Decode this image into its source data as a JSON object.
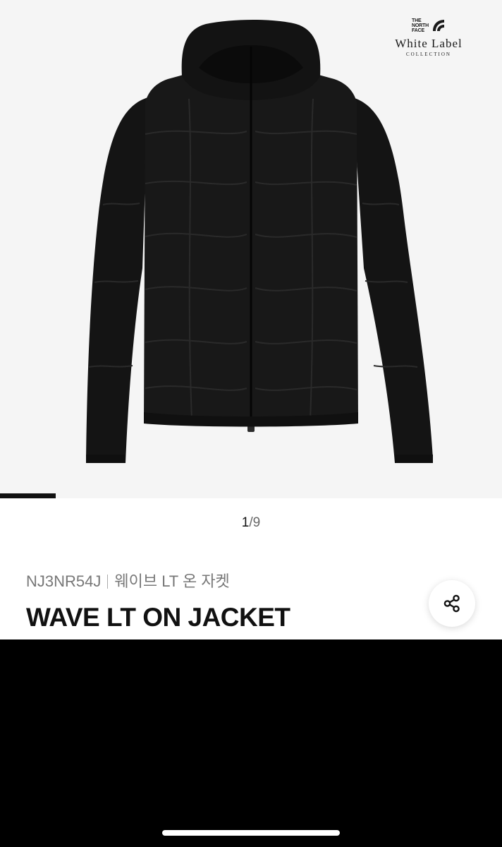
{
  "brand": {
    "tnf_lines": [
      "THE",
      "NORTH",
      "FACE"
    ],
    "title": "White Label",
    "subtitle": "COLLECTION"
  },
  "gallery": {
    "current": "1",
    "separator": "/",
    "total": "9",
    "progress": 0.111
  },
  "product": {
    "code": "NJ3NR54J",
    "korean_name": "웨이브 LT 온 자켓",
    "name": "WAVE LT ON JACKET"
  },
  "icons": {
    "share": "share-icon"
  },
  "colors": {
    "image_bg": "#f5f5f5",
    "jacket": "#151515",
    "text": "#111111",
    "muted": "#777777"
  }
}
